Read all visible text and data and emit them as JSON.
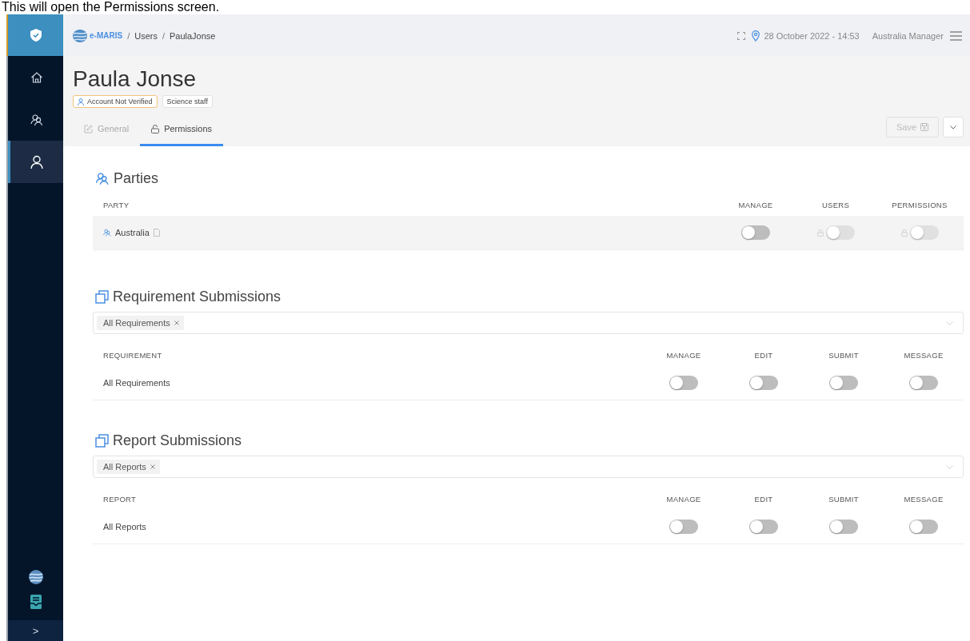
{
  "caption": "This will open the Permissions screen.",
  "sidebar": {
    "items": [
      {
        "kind": "home",
        "selected": false
      },
      {
        "kind": "parties",
        "selected": false
      },
      {
        "kind": "user",
        "selected": true
      }
    ],
    "expand": ">"
  },
  "topbar": {
    "brand": "e-MARIS",
    "separator": "/",
    "breadcrumbs": [
      "Users",
      "PaulaJonse"
    ],
    "datetime": "28 October 2022 - 14:53",
    "user": "Australia Manager"
  },
  "header": {
    "title": "Paula  Jonse",
    "badges": [
      {
        "label": "Account Not Verified",
        "kind": "warning"
      },
      {
        "label": "Science staff",
        "kind": "plain"
      }
    ],
    "tabs": [
      {
        "label": "General",
        "selected": false,
        "kind": "edit"
      },
      {
        "label": "Permissions",
        "selected": true,
        "kind": "lock"
      }
    ],
    "save": {
      "label": "Save",
      "disabled": true
    }
  },
  "parties": {
    "title": "Parties",
    "columns": [
      "PARTY",
      "MANAGE",
      "USERS",
      "PERMISSIONS"
    ],
    "rows": [
      {
        "name": "Australia",
        "toggles": [
          {
            "on": false,
            "locked": false
          },
          {
            "on": false,
            "locked": true
          },
          {
            "on": false,
            "locked": true
          }
        ]
      }
    ]
  },
  "sections": [
    {
      "title": "Requirement Submissions",
      "filter": [
        "All Requirements"
      ],
      "columns": [
        "REQUIREMENT",
        "MANAGE",
        "EDIT",
        "SUBMIT",
        "MESSAGE"
      ],
      "rows": [
        {
          "name": "All Requirements",
          "toggles": [
            {
              "on": false,
              "locked": false
            },
            {
              "on": false,
              "locked": false
            },
            {
              "on": false,
              "locked": false
            },
            {
              "on": false,
              "locked": false
            }
          ]
        }
      ]
    },
    {
      "title": "Report Submissions",
      "filter": [
        "All Reports"
      ],
      "columns": [
        "REPORT",
        "MANAGE",
        "EDIT",
        "SUBMIT",
        "MESSAGE"
      ],
      "rows": [
        {
          "name": "All Reports",
          "toggles": [
            {
              "on": false,
              "locked": false
            },
            {
              "on": false,
              "locked": false
            },
            {
              "on": false,
              "locked": false
            },
            {
              "on": false,
              "locked": false
            }
          ]
        }
      ]
    }
  ]
}
